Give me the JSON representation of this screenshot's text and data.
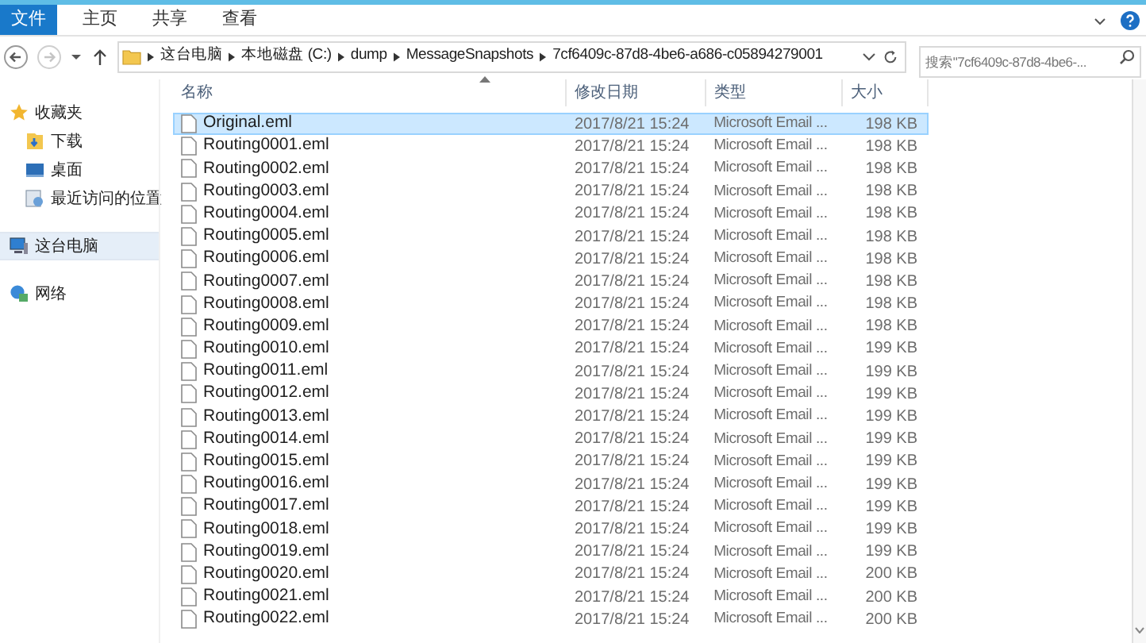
{
  "ribbon": {
    "tabs": [
      {
        "label": "文件",
        "selected": true
      },
      {
        "label": "主页",
        "selected": false
      },
      {
        "label": "共享",
        "selected": false
      },
      {
        "label": "查看",
        "selected": false
      }
    ]
  },
  "address_bar": {
    "path": [
      "这台电脑",
      "本地磁盘 (C:)",
      "dump",
      "MessageSnapshots",
      "7cf6409c-87d8-4be6-a686-c05894279001"
    ]
  },
  "search": {
    "placeholder": "搜索\"7cf6409c-87d8-4be6-..."
  },
  "sidebar": {
    "items": [
      {
        "label": "收藏夹",
        "kind": "favorites",
        "selected": false,
        "children": [
          {
            "label": "下载",
            "kind": "downloads",
            "selected": false
          },
          {
            "label": "桌面",
            "kind": "desktop",
            "selected": false
          },
          {
            "label": "最近访问的位置",
            "kind": "recent",
            "selected": false
          }
        ]
      },
      {
        "label": "这台电脑",
        "kind": "computer",
        "selected": true
      },
      {
        "label": "网络",
        "kind": "network",
        "selected": false
      }
    ]
  },
  "table": {
    "columns": [
      "名称",
      "修改日期",
      "类型",
      "大小"
    ],
    "rows": [
      {
        "name": "Original.eml",
        "date": "2017/8/21 15:24",
        "type": "Microsoft Email ...",
        "size": "198 KB",
        "selected": true
      },
      {
        "name": "Routing0001.eml",
        "date": "2017/8/21 15:24",
        "type": "Microsoft Email ...",
        "size": "198 KB",
        "selected": false
      },
      {
        "name": "Routing0002.eml",
        "date": "2017/8/21 15:24",
        "type": "Microsoft Email ...",
        "size": "198 KB",
        "selected": false
      },
      {
        "name": "Routing0003.eml",
        "date": "2017/8/21 15:24",
        "type": "Microsoft Email ...",
        "size": "198 KB",
        "selected": false
      },
      {
        "name": "Routing0004.eml",
        "date": "2017/8/21 15:24",
        "type": "Microsoft Email ...",
        "size": "198 KB",
        "selected": false
      },
      {
        "name": "Routing0005.eml",
        "date": "2017/8/21 15:24",
        "type": "Microsoft Email ...",
        "size": "198 KB",
        "selected": false
      },
      {
        "name": "Routing0006.eml",
        "date": "2017/8/21 15:24",
        "type": "Microsoft Email ...",
        "size": "198 KB",
        "selected": false
      },
      {
        "name": "Routing0007.eml",
        "date": "2017/8/21 15:24",
        "type": "Microsoft Email ...",
        "size": "198 KB",
        "selected": false
      },
      {
        "name": "Routing0008.eml",
        "date": "2017/8/21 15:24",
        "type": "Microsoft Email ...",
        "size": "198 KB",
        "selected": false
      },
      {
        "name": "Routing0009.eml",
        "date": "2017/8/21 15:24",
        "type": "Microsoft Email ...",
        "size": "198 KB",
        "selected": false
      },
      {
        "name": "Routing0010.eml",
        "date": "2017/8/21 15:24",
        "type": "Microsoft Email ...",
        "size": "199 KB",
        "selected": false
      },
      {
        "name": "Routing0011.eml",
        "date": "2017/8/21 15:24",
        "type": "Microsoft Email ...",
        "size": "199 KB",
        "selected": false
      },
      {
        "name": "Routing0012.eml",
        "date": "2017/8/21 15:24",
        "type": "Microsoft Email ...",
        "size": "199 KB",
        "selected": false
      },
      {
        "name": "Routing0013.eml",
        "date": "2017/8/21 15:24",
        "type": "Microsoft Email ...",
        "size": "199 KB",
        "selected": false
      },
      {
        "name": "Routing0014.eml",
        "date": "2017/8/21 15:24",
        "type": "Microsoft Email ...",
        "size": "199 KB",
        "selected": false
      },
      {
        "name": "Routing0015.eml",
        "date": "2017/8/21 15:24",
        "type": "Microsoft Email ...",
        "size": "199 KB",
        "selected": false
      },
      {
        "name": "Routing0016.eml",
        "date": "2017/8/21 15:24",
        "type": "Microsoft Email ...",
        "size": "199 KB",
        "selected": false
      },
      {
        "name": "Routing0017.eml",
        "date": "2017/8/21 15:24",
        "type": "Microsoft Email ...",
        "size": "199 KB",
        "selected": false
      },
      {
        "name": "Routing0018.eml",
        "date": "2017/8/21 15:24",
        "type": "Microsoft Email ...",
        "size": "199 KB",
        "selected": false
      },
      {
        "name": "Routing0019.eml",
        "date": "2017/8/21 15:24",
        "type": "Microsoft Email ...",
        "size": "199 KB",
        "selected": false
      },
      {
        "name": "Routing0020.eml",
        "date": "2017/8/21 15:24",
        "type": "Microsoft Email ...",
        "size": "200 KB",
        "selected": false
      },
      {
        "name": "Routing0021.eml",
        "date": "2017/8/21 15:24",
        "type": "Microsoft Email ...",
        "size": "200 KB",
        "selected": false
      },
      {
        "name": "Routing0022.eml",
        "date": "2017/8/21 15:24",
        "type": "Microsoft Email ...",
        "size": "200 KB",
        "selected": false
      }
    ]
  }
}
